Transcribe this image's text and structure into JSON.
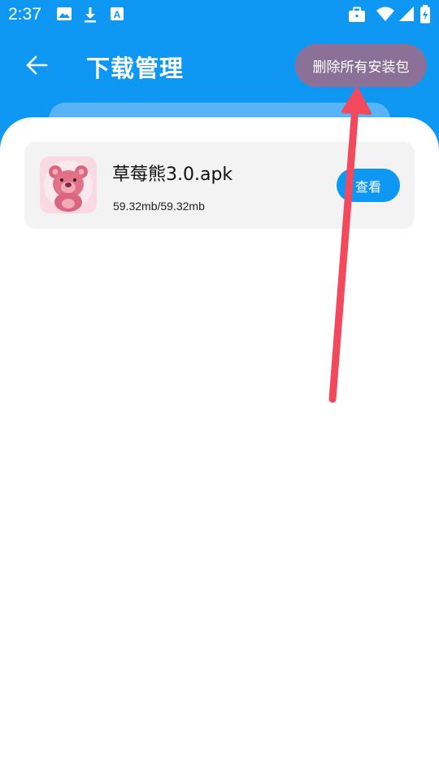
{
  "status_bar": {
    "time": "2:37",
    "left_icons": [
      "image-icon",
      "download-icon",
      "font-icon"
    ],
    "right_icons": [
      "briefcase-icon",
      "wifi-icon",
      "signal-icon",
      "battery-icon"
    ]
  },
  "header": {
    "back_icon": "arrow-left-icon",
    "title": "下载管理",
    "delete_all_label": "删除所有安装包"
  },
  "downloads": [
    {
      "name": "草莓熊3.0.apk",
      "size": "59.32mb/59.32mb",
      "action_label": "查看",
      "icon": "strawberry-bear-app-icon"
    }
  ],
  "colors": {
    "primary": "#0f98f3",
    "delete_button": "#8b7098",
    "arrow": "#f2495c",
    "card": "#f3f3f3"
  }
}
